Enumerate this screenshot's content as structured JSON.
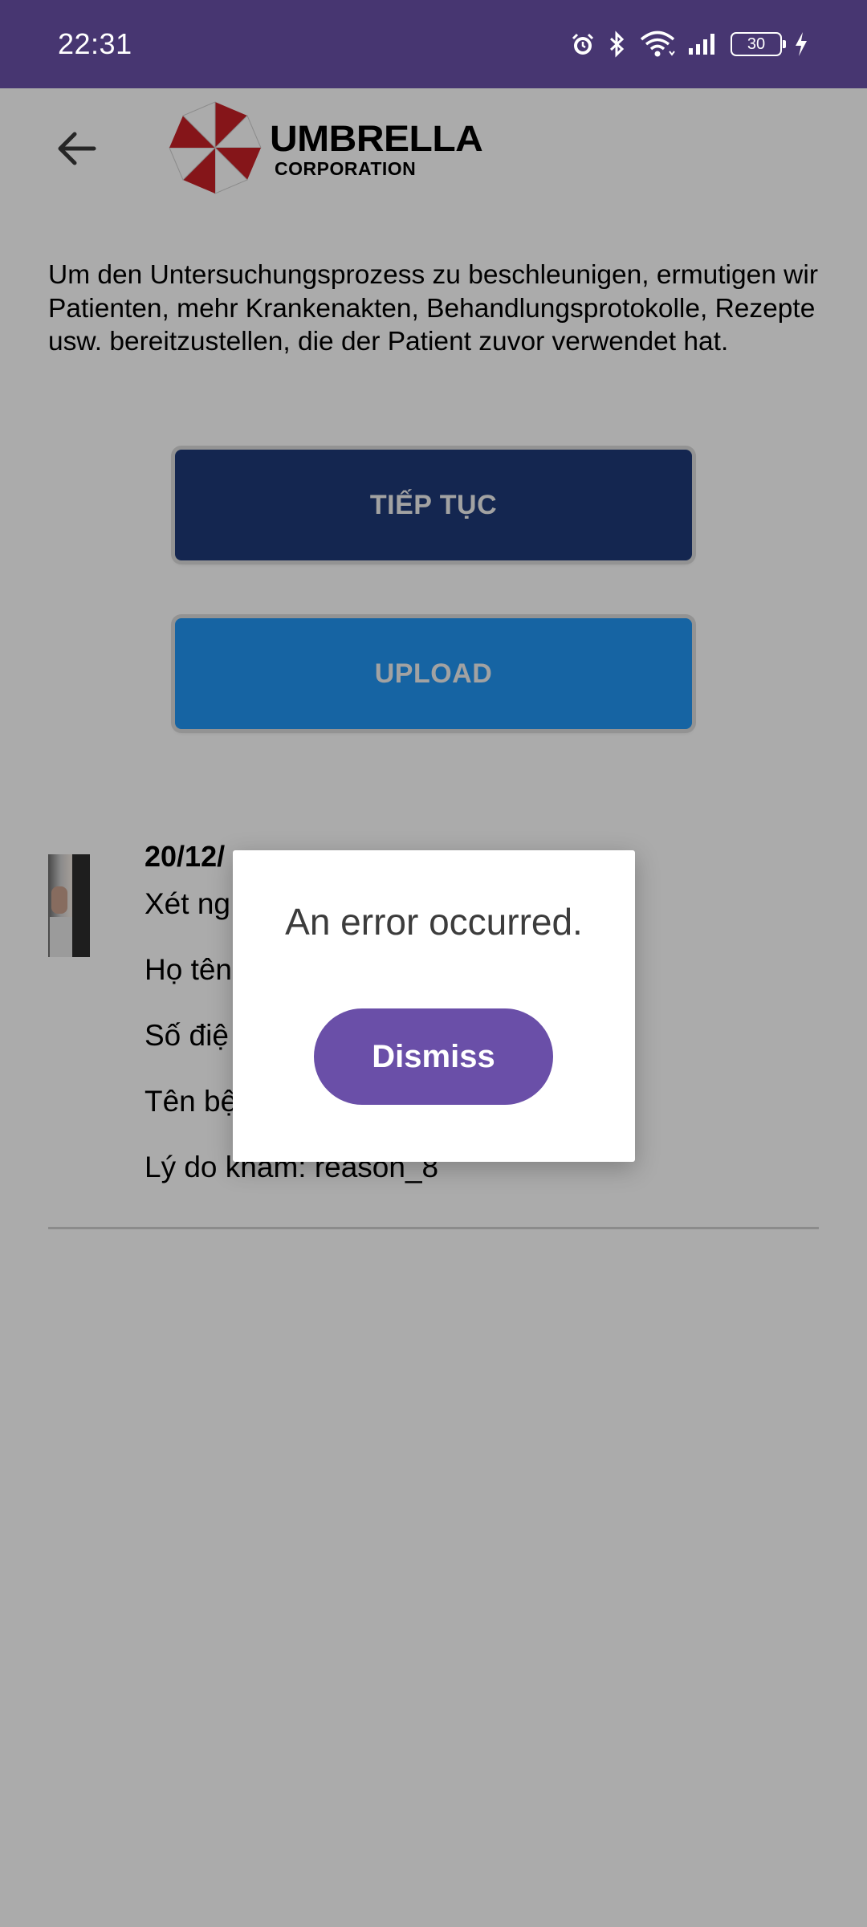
{
  "status_bar": {
    "time": "22:31",
    "battery_level": "30",
    "icons": [
      "alarm-icon",
      "bluetooth-icon",
      "wifi-icon",
      "signal-icon",
      "battery-icon",
      "charging-icon"
    ]
  },
  "header": {
    "back_icon": "arrow-left-icon",
    "logo_title": "UMBRELLA",
    "logo_subtitle": "CORPORATION"
  },
  "intro_text": "Um den Untersuchungsprozess zu beschleunigen, ermutigen wir Patienten, mehr Krankenakten, Behandlungsprotokolle, Rezepte usw. bereitzustellen, die der Patient zuvor verwendet hat.",
  "buttons": {
    "continue_label": "TIẾP TỤC",
    "upload_label": "UPLOAD"
  },
  "record": {
    "date": "20/12/",
    "lines": [
      "Xét ng",
      "Họ tên",
      "Số điệ",
      "Tên bệ",
      "Lý do khám: reason_8"
    ]
  },
  "dialog": {
    "message": "An error occurred.",
    "dismiss_label": "Dismiss"
  },
  "colors": {
    "status_bar": "#473671",
    "continue_button": "#1e3a78",
    "upload_button": "#2196f3",
    "dismiss_button": "#6a4fa8",
    "scrim": "rgba(0,0,0,0.33)"
  }
}
